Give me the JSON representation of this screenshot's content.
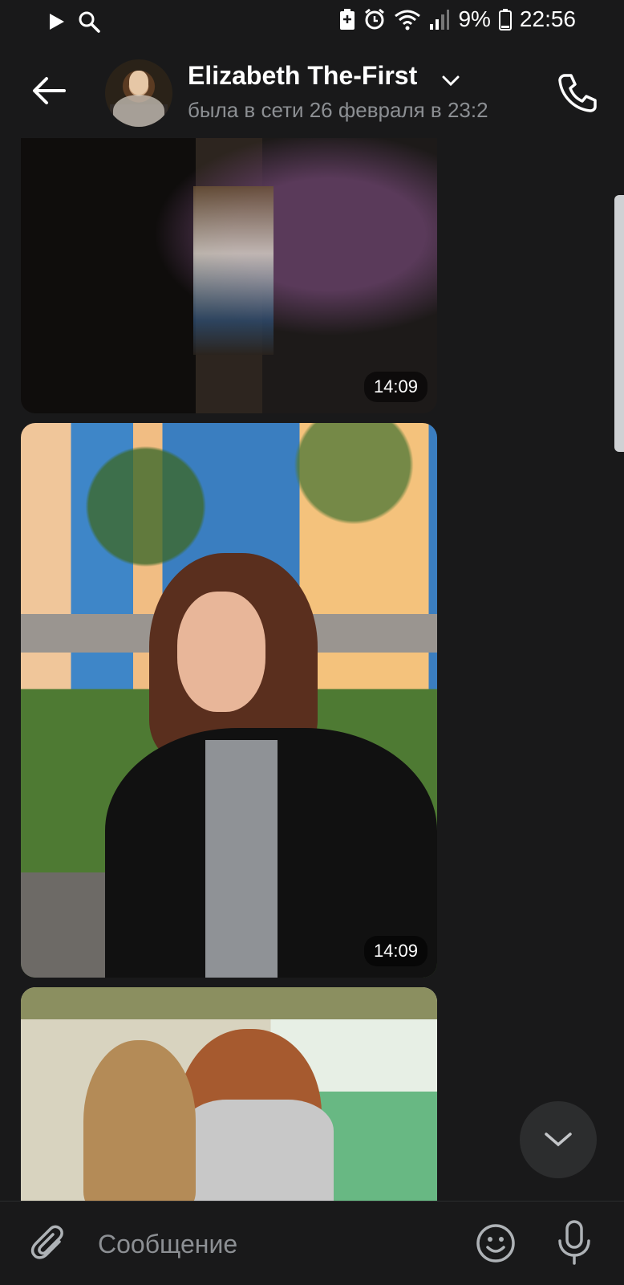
{
  "status_bar": {
    "battery_percent": "9%",
    "time": "22:56",
    "icons": [
      "play-icon",
      "search-icon",
      "battery-saver-icon",
      "alarm-icon",
      "wifi-icon",
      "signal-icon",
      "battery-icon"
    ]
  },
  "header": {
    "contact_name": "Elizabeth The-First",
    "last_seen": "была в сети 26 февраля в 23:2"
  },
  "messages": [
    {
      "type": "photo",
      "time": "14:09"
    },
    {
      "type": "photo",
      "time": "14:09"
    },
    {
      "type": "photo",
      "time": ""
    }
  ],
  "composer": {
    "placeholder": "Сообщение"
  },
  "colors": {
    "background": "#19191a",
    "text_primary": "#ffffff",
    "text_secondary": "#8c8f93",
    "floating_button": "#2c2d2e"
  }
}
